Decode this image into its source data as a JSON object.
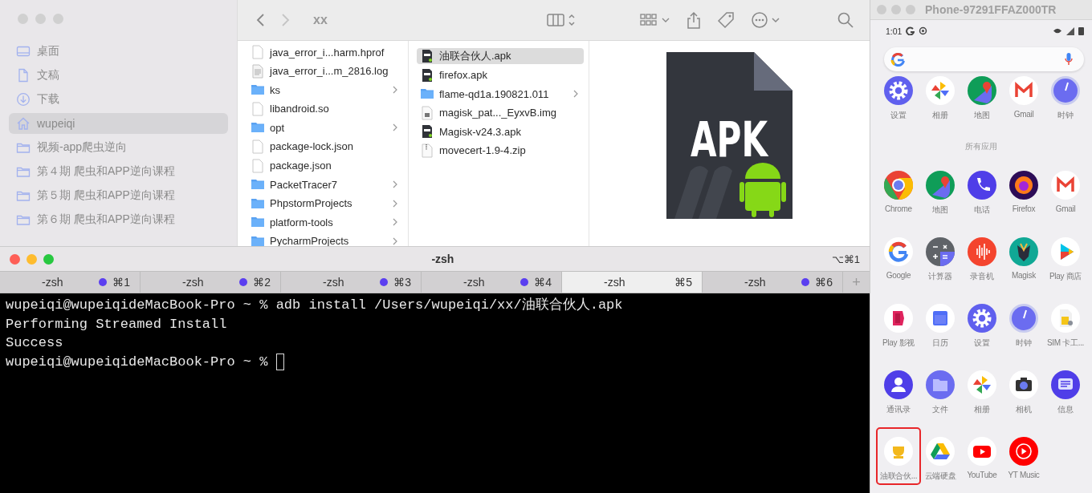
{
  "finder": {
    "title": "xx",
    "sidebar": [
      {
        "label": "桌面",
        "kind": "desktop",
        "selected": false
      },
      {
        "label": "文稿",
        "kind": "document",
        "selected": false
      },
      {
        "label": "下载",
        "kind": "download",
        "selected": false
      },
      {
        "label": "wupeiqi",
        "kind": "home",
        "selected": true
      },
      {
        "label": "视频-app爬虫逆向",
        "kind": "folder",
        "selected": false
      },
      {
        "label": "第４期 爬虫和APP逆向课程",
        "kind": "folder",
        "selected": false
      },
      {
        "label": "第５期 爬虫和APP逆向课程",
        "kind": "folder",
        "selected": false
      },
      {
        "label": "第６期 爬虫和APP逆向课程",
        "kind": "folder",
        "selected": false
      }
    ],
    "columns": [
      {
        "items": [
          {
            "name": "java_error_i...harm.hprof",
            "kind": "file",
            "selected": false
          },
          {
            "name": "java_error_i...m_2816.log",
            "kind": "log",
            "selected": false
          },
          {
            "name": "ks",
            "kind": "folder",
            "selected": false
          },
          {
            "name": "libandroid.so",
            "kind": "file",
            "selected": false
          },
          {
            "name": "opt",
            "kind": "folder",
            "selected": false
          },
          {
            "name": "package-lock.json",
            "kind": "file",
            "selected": false
          },
          {
            "name": "package.json",
            "kind": "file",
            "selected": false
          },
          {
            "name": "PacketTracer7",
            "kind": "folder",
            "selected": false
          },
          {
            "name": "PhpstormProjects",
            "kind": "folder",
            "selected": false
          },
          {
            "name": "platform-tools",
            "kind": "folder",
            "selected": false
          },
          {
            "name": "PycharmProjects",
            "kind": "folder",
            "selected": false
          }
        ]
      },
      {
        "items": [
          {
            "name": "油联合伙人.apk",
            "kind": "apk",
            "selected": true
          },
          {
            "name": "firefox.apk",
            "kind": "apk",
            "selected": false
          },
          {
            "name": "flame-qd1a.190821.011",
            "kind": "folder",
            "selected": false
          },
          {
            "name": "magisk_pat..._EyxvB.img",
            "kind": "image",
            "selected": false
          },
          {
            "name": "Magisk-v24.3.apk",
            "kind": "apk",
            "selected": false
          },
          {
            "name": "movecert-1.9-4.zip",
            "kind": "zip",
            "selected": false
          }
        ]
      }
    ],
    "preview": {
      "icon_text": "APK"
    }
  },
  "terminal": {
    "title": "-zsh",
    "shortcut": "⌥⌘1",
    "tabs": [
      {
        "label": "-zsh",
        "shortcut": "⌘1",
        "activity": true,
        "selected": false
      },
      {
        "label": "-zsh",
        "shortcut": "⌘2",
        "activity": true,
        "selected": false
      },
      {
        "label": "-zsh",
        "shortcut": "⌘3",
        "activity": true,
        "selected": false
      },
      {
        "label": "-zsh",
        "shortcut": "⌘4",
        "activity": true,
        "selected": false
      },
      {
        "label": "-zsh",
        "shortcut": "⌘5",
        "activity": false,
        "selected": true
      },
      {
        "label": "-zsh",
        "shortcut": "⌘6",
        "activity": true,
        "selected": false
      }
    ],
    "new_tab": "+",
    "lines": [
      "wupeiqi@wupeiqideMacBook-Pro ~ % adb install /Users/wupeiqi/xx/油联合伙人.apk",
      "Performing Streamed Install",
      "Success",
      "wupeiqi@wupeiqideMacBook-Pro ~ % "
    ],
    "cursor": true
  },
  "phone": {
    "title": "Phone-97291FFAZ000TR",
    "time": "1:01",
    "section_label": "所有应用",
    "rows": [
      [
        {
          "label": "设置",
          "selected": false
        },
        {
          "label": "相册",
          "selected": false
        },
        {
          "label": "地图",
          "selected": false
        },
        {
          "label": "Gmail",
          "selected": false
        },
        {
          "label": "时钟",
          "selected": false
        }
      ],
      [
        {
          "label": "Chrome",
          "selected": false
        },
        {
          "label": "地图",
          "selected": false
        },
        {
          "label": "电话",
          "selected": false
        },
        {
          "label": "Firefox",
          "selected": false
        },
        {
          "label": "Gmail",
          "selected": false
        }
      ],
      [
        {
          "label": "Google",
          "selected": false
        },
        {
          "label": "计算器",
          "selected": false
        },
        {
          "label": "录音机",
          "selected": false
        },
        {
          "label": "Magisk",
          "selected": false
        },
        {
          "label": "Play 商店",
          "selected": false
        }
      ],
      [
        {
          "label": "Play 影视",
          "selected": false
        },
        {
          "label": "日历",
          "selected": false
        },
        {
          "label": "设置",
          "selected": false
        },
        {
          "label": "时钟",
          "selected": false
        },
        {
          "label": "SIM 卡工...",
          "selected": false
        }
      ],
      [
        {
          "label": "通讯录",
          "selected": false
        },
        {
          "label": "文件",
          "selected": false
        },
        {
          "label": "相册",
          "selected": false
        },
        {
          "label": "相机",
          "selected": false
        },
        {
          "label": "信息",
          "selected": false
        }
      ],
      [
        {
          "label": "油联合伙...",
          "selected": true
        },
        {
          "label": "云端硬盘",
          "selected": false
        },
        {
          "label": "YouTube",
          "selected": false
        },
        {
          "label": "YT Music",
          "selected": false
        }
      ]
    ]
  }
}
